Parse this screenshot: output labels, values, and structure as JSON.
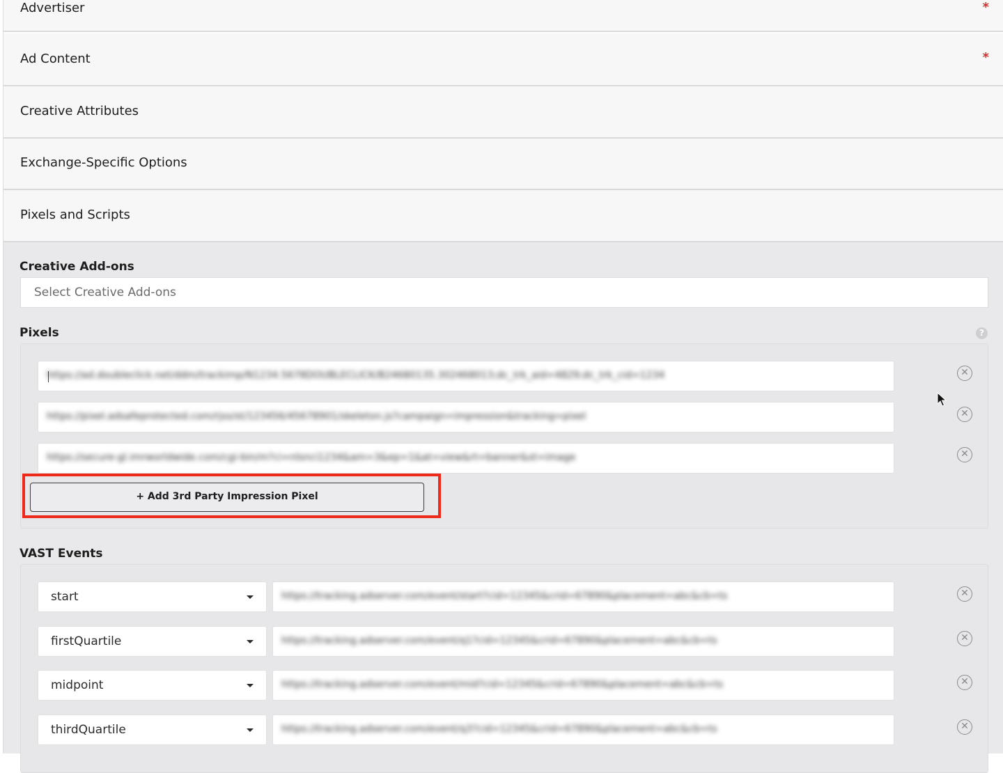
{
  "accordion": {
    "advertiser": {
      "label": "Advertiser",
      "required_mark": "*"
    },
    "ad_content": {
      "label": "Ad Content",
      "required_mark": "*"
    },
    "creative_attributes": {
      "label": "Creative Attributes"
    },
    "exchange_options": {
      "label": "Exchange-Specific Options"
    },
    "pixels_scripts": {
      "label": "Pixels and Scripts"
    }
  },
  "creative_addons": {
    "title": "Creative Add-ons",
    "placeholder": "Select Creative Add-ons"
  },
  "pixels": {
    "title": "Pixels",
    "help_icon": "?",
    "items": [
      {
        "url": "https://ad.doubleclick.net/ddm/trackimp/N1234.5678DOUBLECLICK/B24680135.302468013;dc_trk_aid=4829;dc_trk_cid=1234"
      },
      {
        "url": "https://pixel.adsafeprotected.com/rjss/st/123456/45678901/skeleton.js?campaign=impression&tracking=pixel"
      },
      {
        "url": "https://secure-gl.imrworldwide.com/cgi-bin/m?ci=nlsnci1234&am=3&ep=1&at=view&rt=banner&st=image"
      }
    ],
    "add_button": "+ Add 3rd Party Impression Pixel"
  },
  "vast_events": {
    "title": "VAST Events",
    "items": [
      {
        "event": "start",
        "url": "https://tracking.adserver.com/event/start?cid=12345&crid=67890&placement=abc&cb=ts"
      },
      {
        "event": "firstQuartile",
        "url": "https://tracking.adserver.com/event/q1?cid=12345&crid=67890&placement=abc&cb=ts"
      },
      {
        "event": "midpoint",
        "url": "https://tracking.adserver.com/event/mid?cid=12345&crid=67890&placement=abc&cb=ts"
      },
      {
        "event": "thirdQuartile",
        "url": "https://tracking.adserver.com/event/q3?cid=12345&crid=67890&placement=abc&cb=ts"
      }
    ]
  },
  "icons": {
    "remove": "x-circle-icon",
    "dropdown": "caret-down-icon",
    "cursor": "mouse-pointer-icon"
  },
  "colors": {
    "highlight": "#ee2a1b",
    "required": "#d0302d",
    "panel_bg": "#e9e8ea"
  }
}
